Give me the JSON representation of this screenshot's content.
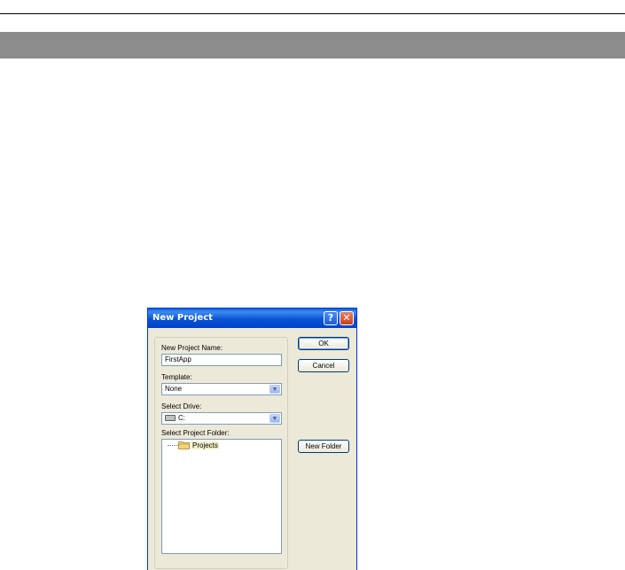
{
  "dialog": {
    "title": "New Project",
    "help_glyph": "?",
    "close_glyph": "✕",
    "project_name_label": "New Project Name:",
    "project_name_value": "FirstApp",
    "template_label": "Template:",
    "template_value": "None",
    "drive_label": "Select Drive:",
    "drive_value": "C:",
    "folder_label": "Select Project Folder:",
    "folder_tree": [
      {
        "label": "Projects",
        "icon": "folder-icon"
      }
    ],
    "ok_label": "OK",
    "cancel_label": "Cancel",
    "new_folder_label": "New Folder"
  },
  "colors": {
    "title_bar": "#0a53d2",
    "dialog_bg": "#ece9d8",
    "section_band": "#8c8c8c"
  }
}
